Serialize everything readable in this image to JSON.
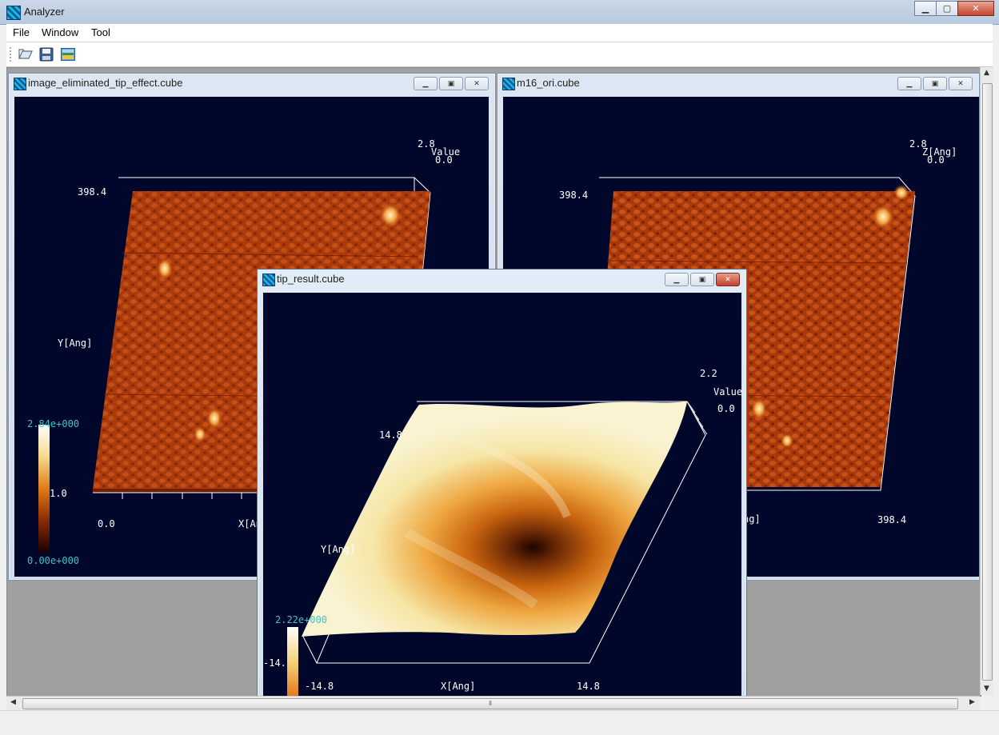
{
  "app": {
    "title": "Analyzer"
  },
  "menu": {
    "file": "File",
    "window": "Window",
    "tool": "Tool"
  },
  "toolbar": {
    "open_icon": "folder-open-icon",
    "save_icon": "save-icon",
    "image_icon": "image-icon"
  },
  "windows": {
    "left": {
      "title": "image_eliminated_tip_effect.cube",
      "z_max": "2.8",
      "z_label": "Value",
      "z_min": "0.0",
      "y_max": "398.4",
      "y_label": "Y[Ang]",
      "x_min": "0.0",
      "x_label": "X[Ang]",
      "cb_max": "2.84e+000",
      "cb_mid": "1.0",
      "cb_min": "0.00e+000"
    },
    "right": {
      "title": "m16_ori.cube",
      "z_max": "2.8",
      "z_label": "Z[Ang]",
      "z_min": "0.0",
      "y_max": "398.4",
      "x_max": "398.4",
      "x_label_tail": "ng]"
    },
    "front": {
      "title": "tip_result.cube",
      "z_max": "2.2",
      "z_label": "Value",
      "z_min": "0.0",
      "y_max": "14.8",
      "y_label": "Y[Ang]",
      "y_min": "-14.",
      "x_min": "-14.8",
      "x_label": "X[Ang]",
      "x_max": "14.8",
      "cb_max": "2.22e+000"
    }
  },
  "colors": {
    "canvas_bg": "#00072a",
    "afm_surface": "#b5400f",
    "tip_surface": "#f4f0c0",
    "colorbar_label": "#3ec5c8"
  }
}
